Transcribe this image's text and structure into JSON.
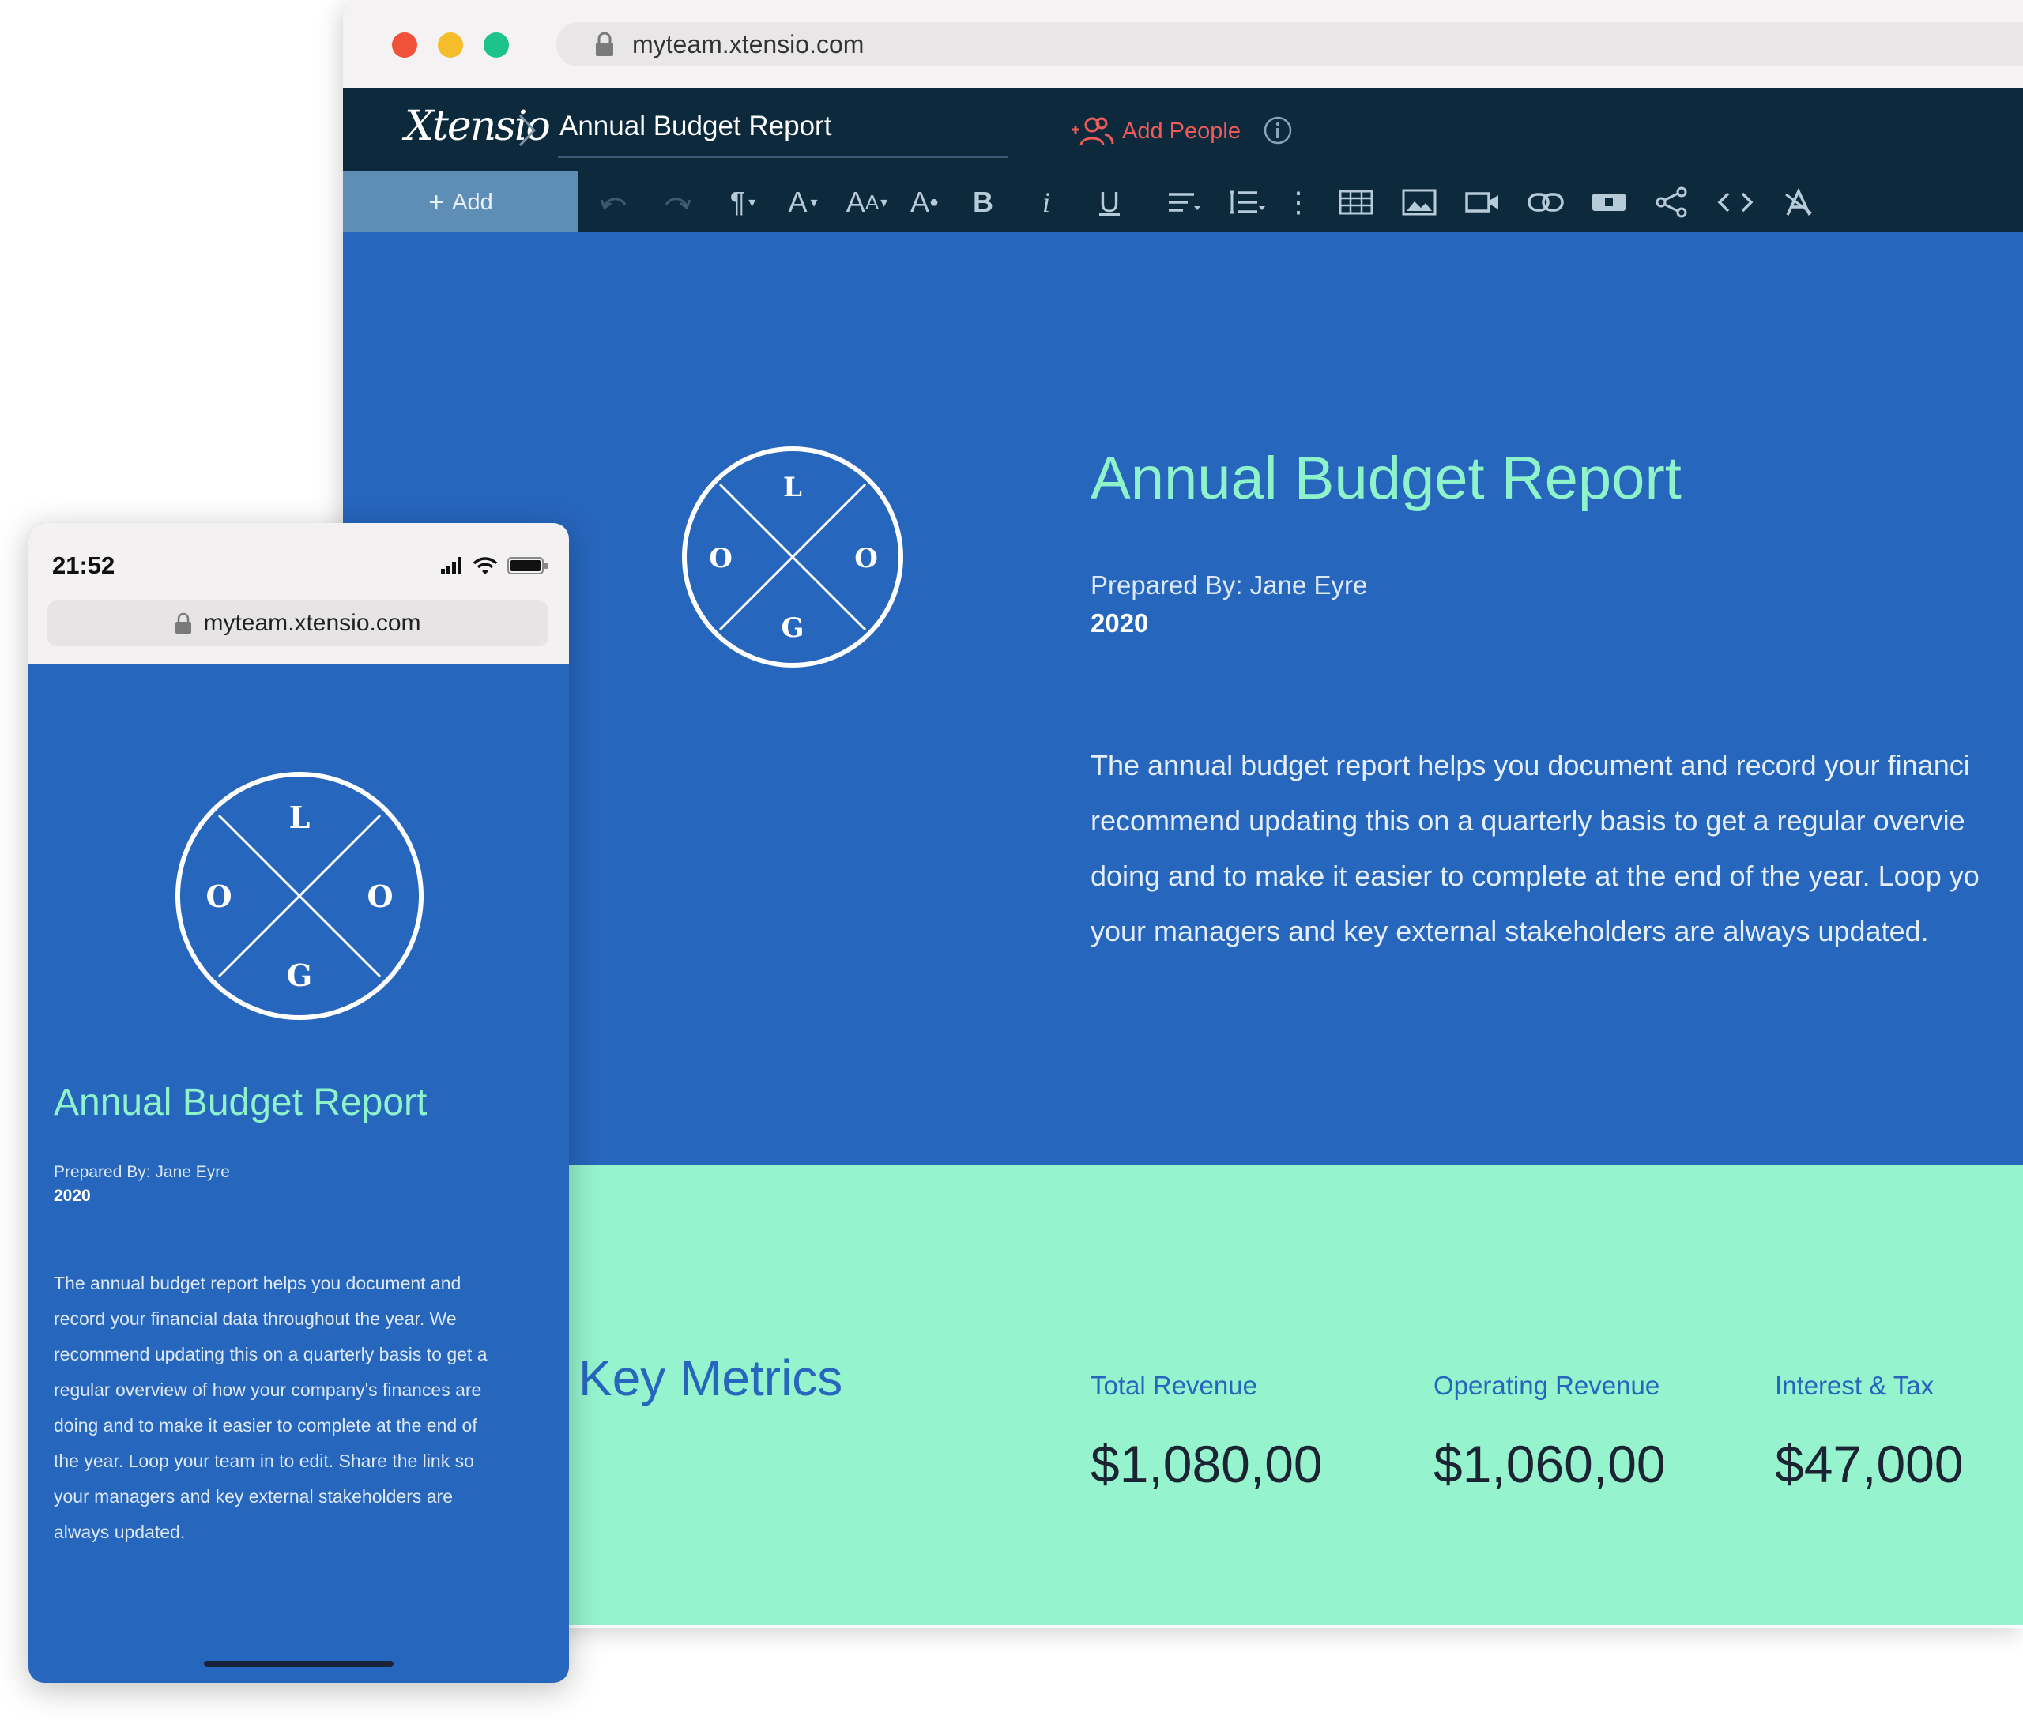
{
  "browser": {
    "url": "myteam.xtensio.com"
  },
  "app": {
    "brand": "Xtensio",
    "document_title": "Annual Budget Report",
    "add_people_label": "Add People",
    "add_label": "Add",
    "toolbar_tools": [
      "undo-icon",
      "redo-icon",
      "paragraph-icon",
      "font-color-icon",
      "font-size-icon",
      "highlight-icon",
      "bold-icon",
      "italic-icon",
      "underline-icon",
      "align-icon",
      "list-icon",
      "more-icon",
      "table-icon",
      "image-icon",
      "video-icon",
      "link-icon",
      "button-icon",
      "share-icon",
      "code-icon",
      "clear-format-icon"
    ]
  },
  "hero": {
    "logo_letters": {
      "top": "L",
      "left": "O",
      "right": "O",
      "bottom": "G"
    },
    "title": "Annual Budget Report",
    "prepared_by": "Prepared By: Jane Eyre",
    "year": "2020",
    "body_lines": [
      "The annual budget report helps you document and record your financi",
      "recommend updating this on a quarterly basis to get a regular overvie",
      "doing and to make it easier to complete at the end of the year. Loop yo",
      "your managers and key external stakeholders are always updated."
    ]
  },
  "metrics": {
    "title": "Key Metrics",
    "items": [
      {
        "label": "Total Revenue",
        "value": "$1,080,00"
      },
      {
        "label": "Operating Revenue",
        "value": "$1,060,00"
      },
      {
        "label": "Interest & Tax",
        "value": "$47,000"
      }
    ]
  },
  "mobile": {
    "time": "21:52",
    "url": "myteam.xtensio.com",
    "title": "Annual Budget Report",
    "prepared_by": "Prepared By: Jane Eyre",
    "year": "2020",
    "body_lines": [
      "The annual budget report helps you document and",
      "record your financial data throughout the year. We",
      "recommend updating this on a quarterly basis to get a",
      "regular overview of how your company's finances are",
      "doing and to make it easier to complete at the end of",
      "the year. Loop your team in to edit. Share the link so",
      "your managers and key external stakeholders are",
      "always updated."
    ]
  },
  "colors": {
    "hero_bg": "#2766bd",
    "accent_mint": "#8ef2cb",
    "metrics_bg": "#95f3cd",
    "header_bg": "#0c2a3c",
    "add_people": "#ef5a5a"
  }
}
